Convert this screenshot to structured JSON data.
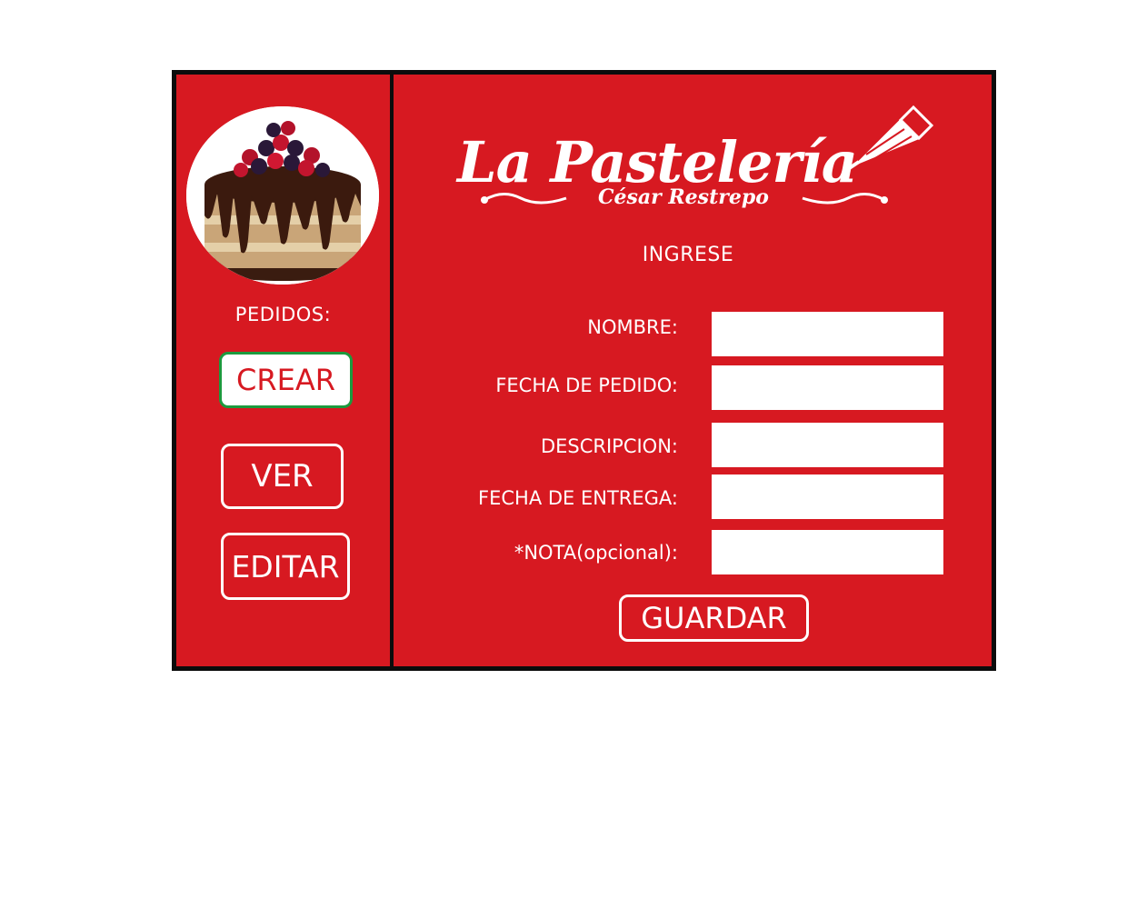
{
  "brand": {
    "logo_title": "La Pastelería",
    "logo_subtitle": "César Restrepo"
  },
  "sidebar": {
    "image_alt": "chocolate cake with berries",
    "heading": "PEDIDOS:",
    "buttons": {
      "crear": "CREAR",
      "ver": "VER",
      "editar": "EDITAR"
    },
    "active_button": "CREAR"
  },
  "form": {
    "heading": "INGRESE",
    "fields": [
      {
        "label": "NOMBRE:",
        "value": ""
      },
      {
        "label": "FECHA DE  PEDIDO:",
        "value": ""
      },
      {
        "label": "DESCRIPCION:",
        "value": ""
      },
      {
        "label": "FECHA DE ENTREGA:",
        "value": ""
      },
      {
        "label": "*NOTA(opcional):",
        "value": ""
      }
    ],
    "save_label": "GUARDAR"
  },
  "colors": {
    "panel_red": "#d71921",
    "frame_black": "#0c0c0c",
    "active_border": "#1c9a3e",
    "text_white": "#ffffff"
  }
}
